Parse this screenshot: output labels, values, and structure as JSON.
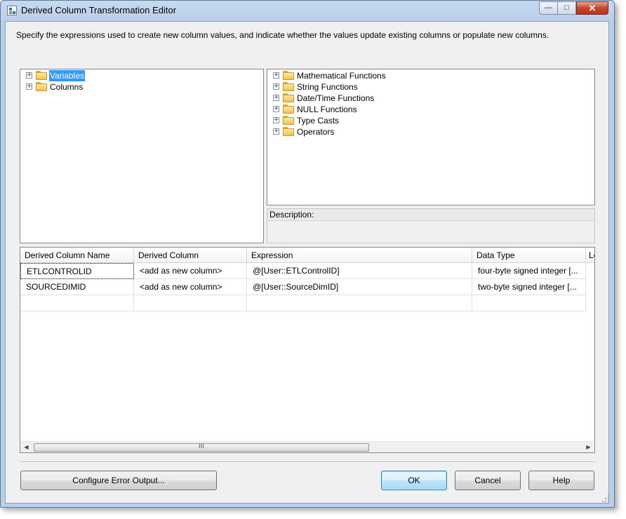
{
  "window": {
    "title": "Derived Column Transformation Editor",
    "minimize_glyph": "—",
    "maximize_glyph": "□",
    "close_glyph": "✕"
  },
  "instructions": "Specify the expressions used to create new column values, and indicate whether the values update existing columns or populate new columns.",
  "left_tree": {
    "items": [
      {
        "label": "Variables",
        "selected": true,
        "icon": "folder-icon"
      },
      {
        "label": "Columns",
        "selected": false,
        "icon": "folder-icon"
      }
    ]
  },
  "right_tree": {
    "items": [
      {
        "label": "Mathematical Functions",
        "icon": "folder-icon"
      },
      {
        "label": "String Functions",
        "icon": "folder-icon"
      },
      {
        "label": "Date/Time Functions",
        "icon": "folder-icon"
      },
      {
        "label": "NULL Functions",
        "icon": "folder-icon"
      },
      {
        "label": "Type Casts",
        "icon": "folder-icon"
      },
      {
        "label": "Operators",
        "icon": "folder-icon"
      }
    ]
  },
  "description": {
    "label": "Description:"
  },
  "grid": {
    "columns": [
      "Derived Column Name",
      "Derived Column",
      "Expression",
      "Data Type",
      "Le"
    ],
    "rows": [
      [
        "ETLCONTROLID",
        "<add as new column>",
        "@[User::ETLControlID]",
        "four-byte signed integer [..."
      ],
      [
        "SOURCEDIMID",
        "<add as new column>",
        "@[User::SourceDimID]",
        "two-byte signed integer [..."
      ],
      [
        "",
        "",
        "",
        ""
      ]
    ],
    "scroll_thumb_glyph": "III",
    "scroll_left_glyph": "◀",
    "scroll_right_glyph": "▶"
  },
  "buttons": {
    "configure_error_output": "Configure Error Output...",
    "ok": "OK",
    "cancel": "Cancel",
    "help": "Help"
  },
  "colors": {
    "selection": "#3399ff",
    "dialog_background": "#f0f0f0",
    "title_bar": "#b9cfe8"
  }
}
